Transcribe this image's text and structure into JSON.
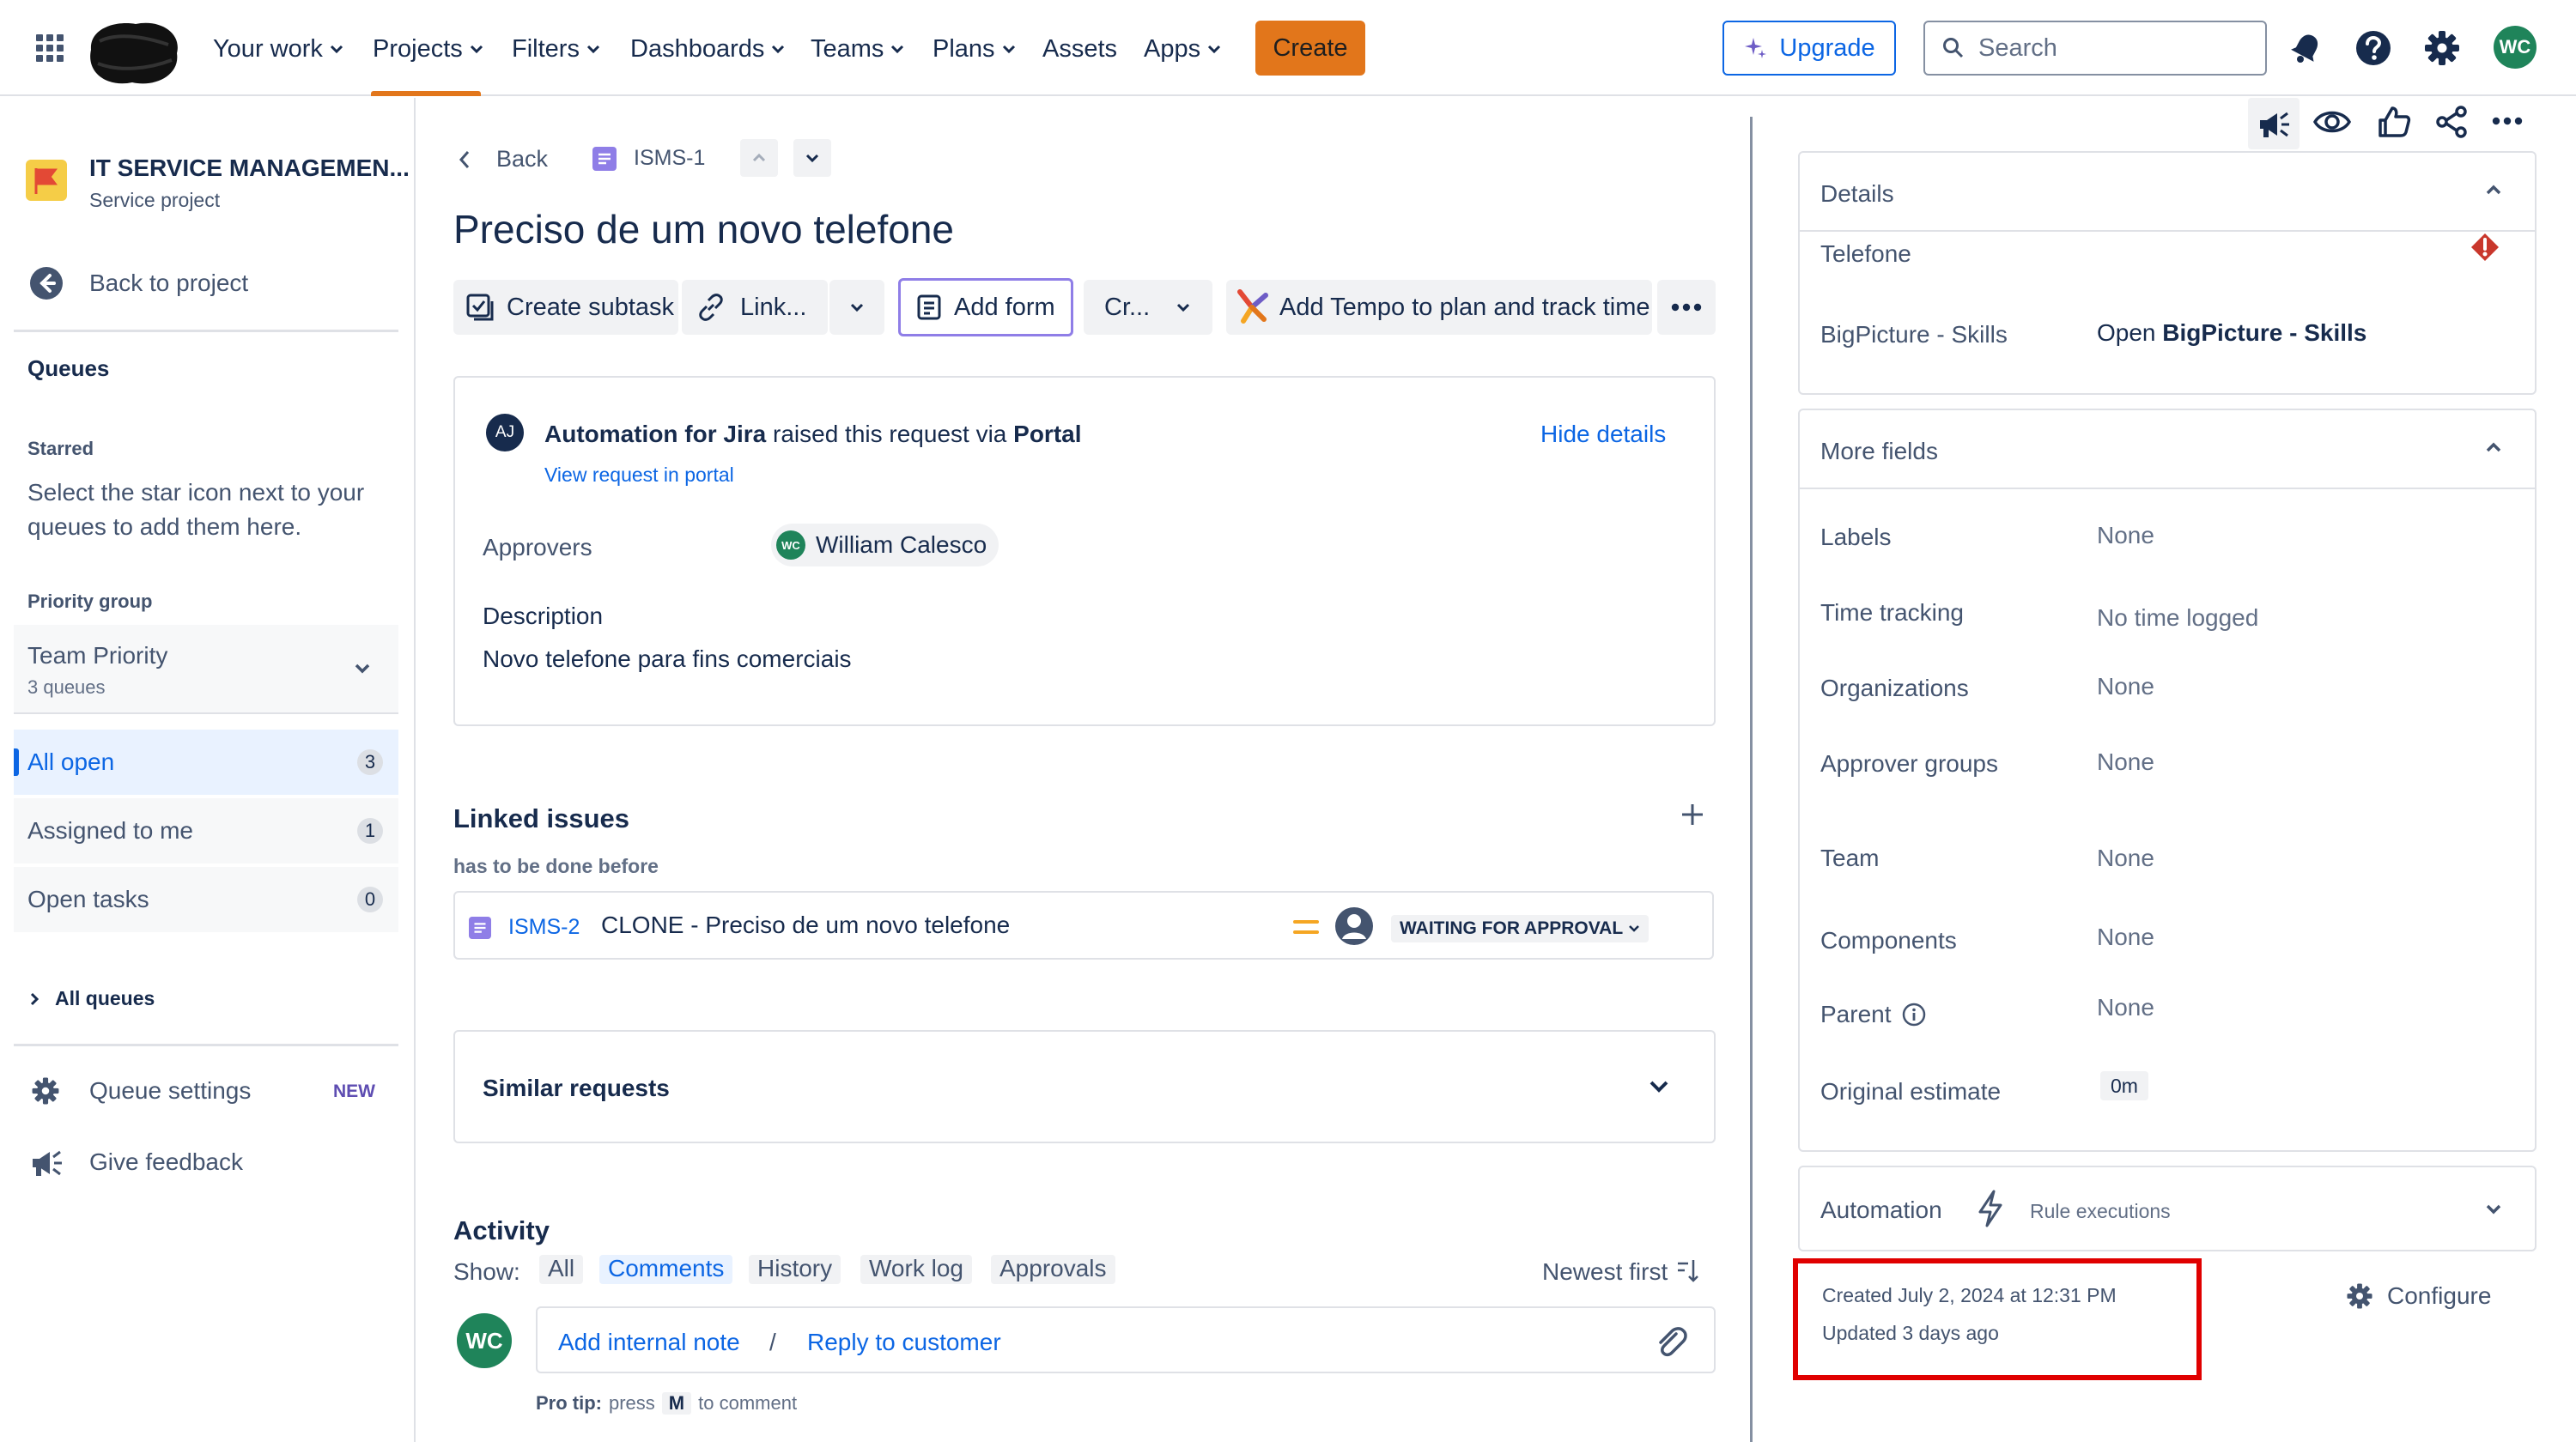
{
  "nav": {
    "items": [
      {
        "label": "Your work",
        "chevron": true
      },
      {
        "label": "Projects",
        "chevron": true
      },
      {
        "label": "Filters",
        "chevron": true
      },
      {
        "label": "Dashboards",
        "chevron": true
      },
      {
        "label": "Teams",
        "chevron": true
      },
      {
        "label": "Plans",
        "chevron": true
      },
      {
        "label": "Assets",
        "chevron": false
      },
      {
        "label": "Apps",
        "chevron": true
      }
    ],
    "create_label": "Create",
    "upgrade_label": "Upgrade",
    "search_placeholder": "Search",
    "avatar_initials": "WC",
    "accent": "#e2761b"
  },
  "sidebar": {
    "project_name": "IT SERVICE MANAGEMEN...",
    "project_type": "Service project",
    "back_label": "Back to project",
    "queues_heading": "Queues",
    "starred_heading": "Starred",
    "starred_hint_1": "Select the star icon next to your",
    "starred_hint_2": "queues to add them here.",
    "priority_heading": "Priority group",
    "team_priority": "Team Priority",
    "team_priority_sub": "3 queues",
    "queues": [
      {
        "label": "All open",
        "count": "3"
      },
      {
        "label": "Assigned to me",
        "count": "1"
      },
      {
        "label": "Open tasks",
        "count": "0"
      }
    ],
    "all_queues": "All queues",
    "queue_settings": "Queue settings",
    "new_badge": "NEW",
    "give_feedback": "Give feedback"
  },
  "issue": {
    "back_label": "Back",
    "key": "ISMS-1",
    "title": "Preciso de um novo telefone",
    "toolbar": {
      "create_subtask": "Create subtask",
      "link": "Link...",
      "add_form": "Add form",
      "cr": "Cr...",
      "tempo": "Add Tempo to plan and track time"
    },
    "request": {
      "avatar": "AJ",
      "reporter": "Automation for Jira",
      "raised_text": "raised this request via",
      "channel": "Portal",
      "view_portal": "View request in portal",
      "hide_details": "Hide details",
      "approvers_label": "Approvers",
      "approver_initials": "WC",
      "approver_name": "William Calesco",
      "description_label": "Description",
      "description": "Novo telefone para fins comerciais"
    },
    "linked": {
      "heading": "Linked issues",
      "relation": "has to be done before",
      "key": "ISMS-2",
      "summary": "CLONE - Preciso de um novo telefone",
      "status": "WAITING FOR APPROVAL"
    },
    "similar_heading": "Similar requests",
    "activity": {
      "heading": "Activity",
      "show_label": "Show:",
      "tabs": [
        "All",
        "Comments",
        "History",
        "Work log",
        "Approvals"
      ],
      "sort": "Newest first",
      "avatar": "WC",
      "add_note": "Add internal note",
      "separator": "/",
      "reply": "Reply to customer",
      "tip_bold": "Pro tip:",
      "tip_press": "press",
      "tip_key": "M",
      "tip_end": "to comment"
    }
  },
  "details": {
    "heading": "Details",
    "telefone_label": "Telefone",
    "bigpicture_label": "BigPicture - Skills",
    "bigpicture_open": "Open",
    "bigpicture_value": "BigPicture - Skills"
  },
  "more_fields": {
    "heading": "More fields",
    "rows": [
      {
        "label": "Labels",
        "value": "None"
      },
      {
        "label": "Time tracking",
        "value": "No time logged"
      },
      {
        "label": "Organizations",
        "value": "None"
      },
      {
        "label": "Approver groups",
        "value": "None"
      },
      {
        "label": "Team",
        "value": "None"
      },
      {
        "label": "Components",
        "value": "None"
      },
      {
        "label": "Parent",
        "value": "None"
      },
      {
        "label": "Original estimate",
        "value": "0m"
      }
    ]
  },
  "automation": {
    "heading": "Automation",
    "rule_executions": "Rule executions"
  },
  "footer": {
    "created": "Created July 2, 2024 at 12:31 PM",
    "updated": "Updated 3 days ago",
    "configure": "Configure",
    "highlight_color": "#e00000"
  }
}
